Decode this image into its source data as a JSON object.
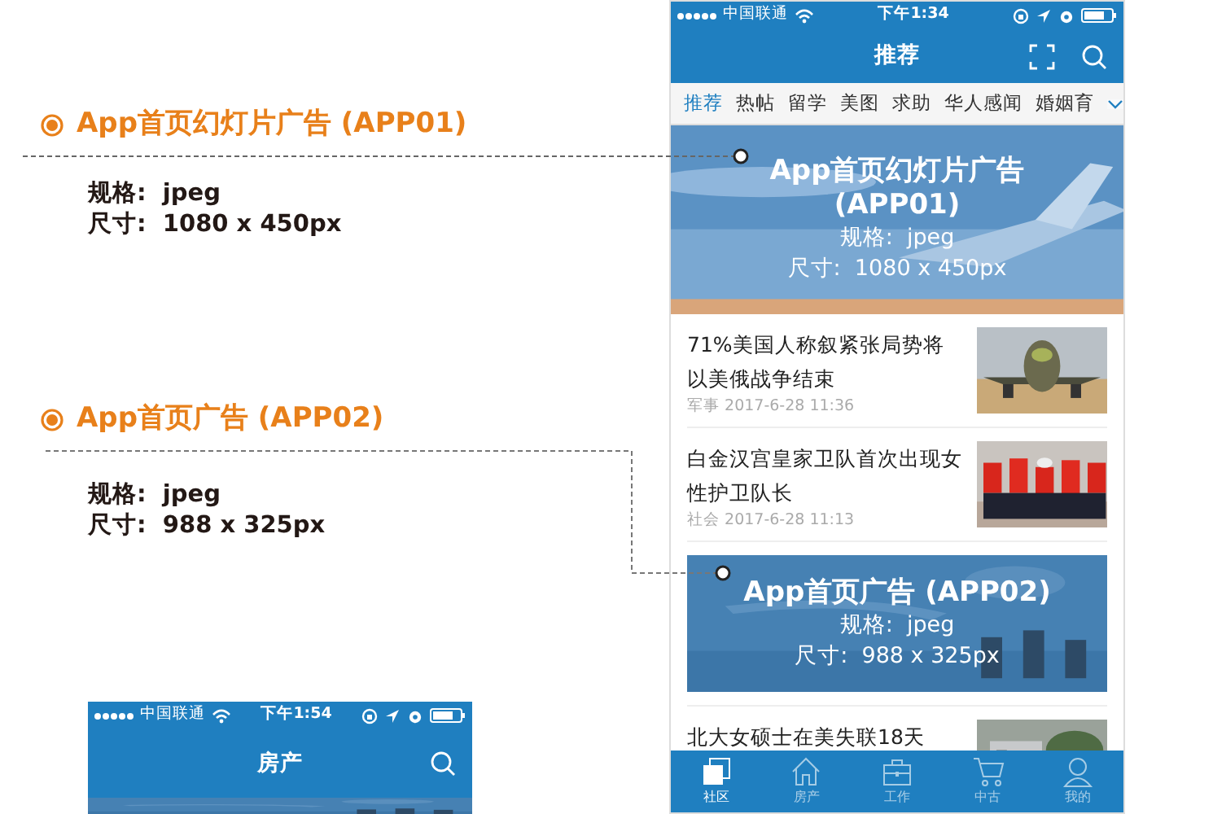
{
  "annotations": [
    {
      "title": "App首页幻灯片广告 (APP01)",
      "format": "规格:  jpeg",
      "size": "尺寸:  1080 x 450px"
    },
    {
      "title": "App首页广告 (APP02)",
      "format": "规格:  jpeg",
      "size": "尺寸:  988 x 325px"
    }
  ],
  "phone": {
    "status_bar": {
      "carrier": "中国联通",
      "time": "下午1:34"
    },
    "title": "推荐",
    "tabs": [
      {
        "label": "推荐",
        "selected": true
      },
      {
        "label": "热帖",
        "selected": false
      },
      {
        "label": "留学",
        "selected": false
      },
      {
        "label": "美图",
        "selected": false
      },
      {
        "label": "求助",
        "selected": false
      },
      {
        "label": "华人感闻",
        "selected": false
      },
      {
        "label": "婚姻育",
        "selected": false
      }
    ],
    "slide_ad": {
      "kind": "picture",
      "title": "App首页幻灯片广告 (APP01)",
      "format": "规格:  jpeg",
      "size": "尺寸:  1080 x 450px"
    },
    "feed": [
      {
        "kind": "article",
        "title": "71%美国人称叙紧张局势将以美俄战争结束",
        "meta": "军事 2017-6-28 11:36"
      },
      {
        "kind": "article",
        "title": "白金汉宫皇家卫队首次出现女性护卫队长",
        "meta": "社会 2017-6-28 11:13"
      },
      {
        "kind": "ad",
        "title": "App首页广告 (APP02)",
        "format": "规格:  jpeg",
        "size": "尺寸:  988 x 325px"
      },
      {
        "kind": "article",
        "title": "北大女硕士在美失联18天"
      }
    ],
    "tab_bar": [
      {
        "label": "社区",
        "selected": true
      },
      {
        "label": "房产",
        "selected": false
      },
      {
        "label": "工作",
        "selected": false
      },
      {
        "label": "中古",
        "selected": false
      },
      {
        "label": "我的",
        "selected": false
      }
    ]
  },
  "phone_2": {
    "status_bar": {
      "carrier": "中国联通",
      "time": "下午1:54"
    },
    "title": "房产"
  }
}
